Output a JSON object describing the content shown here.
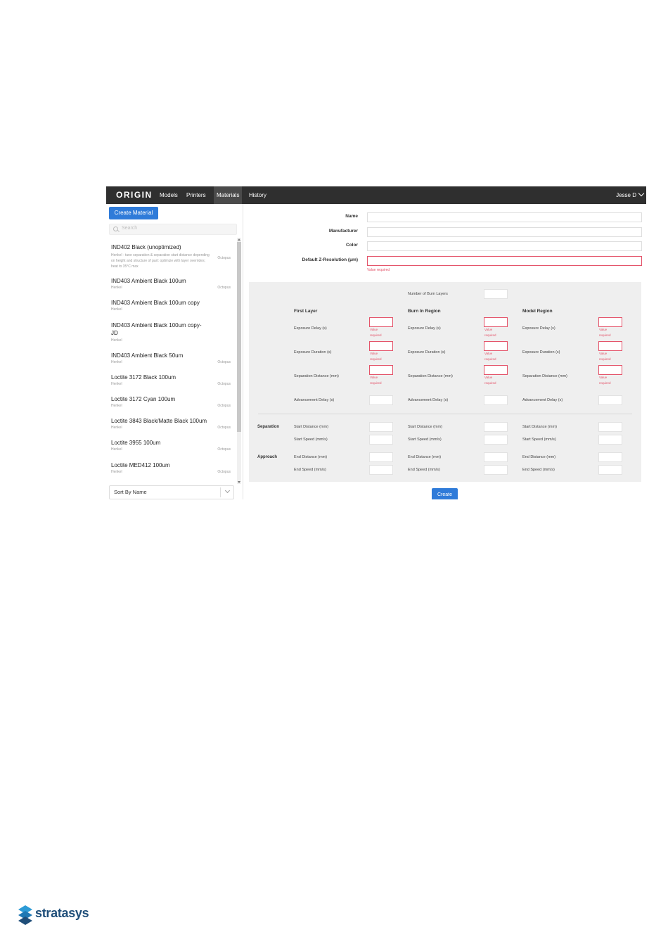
{
  "app": {
    "logo": "ORIGIN",
    "nav": [
      "Models",
      "Printers",
      "Materials",
      "History"
    ],
    "active_nav": "Materials",
    "user": "Jesse D"
  },
  "sidebar": {
    "create_label": "Create Material",
    "search_placeholder": "Search",
    "items": [
      {
        "name": "IND402 Black (unoptimized)",
        "desc": "Henkel - tune separation & separation start distance depending on height and structure of part: optimize with layer overrides; heat to 35°C max",
        "maker": "",
        "printer": "Octopus"
      },
      {
        "name": "IND403 Ambient Black 100um",
        "desc": "",
        "maker": "Henkel",
        "printer": "Octopus"
      },
      {
        "name": "IND403 Ambient Black 100um copy",
        "desc": "",
        "maker": "Henkel",
        "printer": ""
      },
      {
        "name": "IND403 Ambient Black 100um copy-JD",
        "desc": "",
        "maker": "Henkel",
        "printer": ""
      },
      {
        "name": "IND403 Ambient Black 50um",
        "desc": "",
        "maker": "Henkel",
        "printer": "Octopus"
      },
      {
        "name": "Loctite 3172 Black 100um",
        "desc": "",
        "maker": "Henkel",
        "printer": "Octopus"
      },
      {
        "name": "Loctite 3172 Cyan 100um",
        "desc": "",
        "maker": "Henkel",
        "printer": "Octopus"
      },
      {
        "name": "Loctite 3843 Black/Matte Black 100um",
        "desc": "",
        "maker": "Henkel",
        "printer": "Octopus"
      },
      {
        "name": "Loctite 3955 100um",
        "desc": "",
        "maker": "Henkel",
        "printer": "Octopus"
      },
      {
        "name": "Loctite MED412 100um",
        "desc": "",
        "maker": "Henkel",
        "printer": "Octopus"
      }
    ],
    "sort_label": "Sort By Name"
  },
  "form": {
    "name_label": "Name",
    "manufacturer_label": "Manufacturer",
    "color_label": "Color",
    "zres_label": "Default Z-Resolution (μm)",
    "value_required": "Value required",
    "burn_layers_label": "Number of Burn Layers",
    "columns": [
      "First Layer",
      "Burn In Region",
      "Model Region"
    ],
    "exposure_delay": "Exposure Delay (s)",
    "exposure_duration": "Exposure Duration (s)",
    "separation_distance": "Separation Distance (mm)",
    "advancement_delay": "Advancement Delay (s)",
    "separation_group": "Separation",
    "approach_group": "Approach",
    "start_distance": "Start Distance (mm)",
    "start_speed": "Start Speed (mm/s)",
    "end_distance": "End Distance (mm)",
    "end_speed": "End Speed (mm/s)",
    "value_line1": "Value",
    "value_line2": "required",
    "create_label": "Create"
  },
  "footer": {
    "brand": "stratasys"
  }
}
